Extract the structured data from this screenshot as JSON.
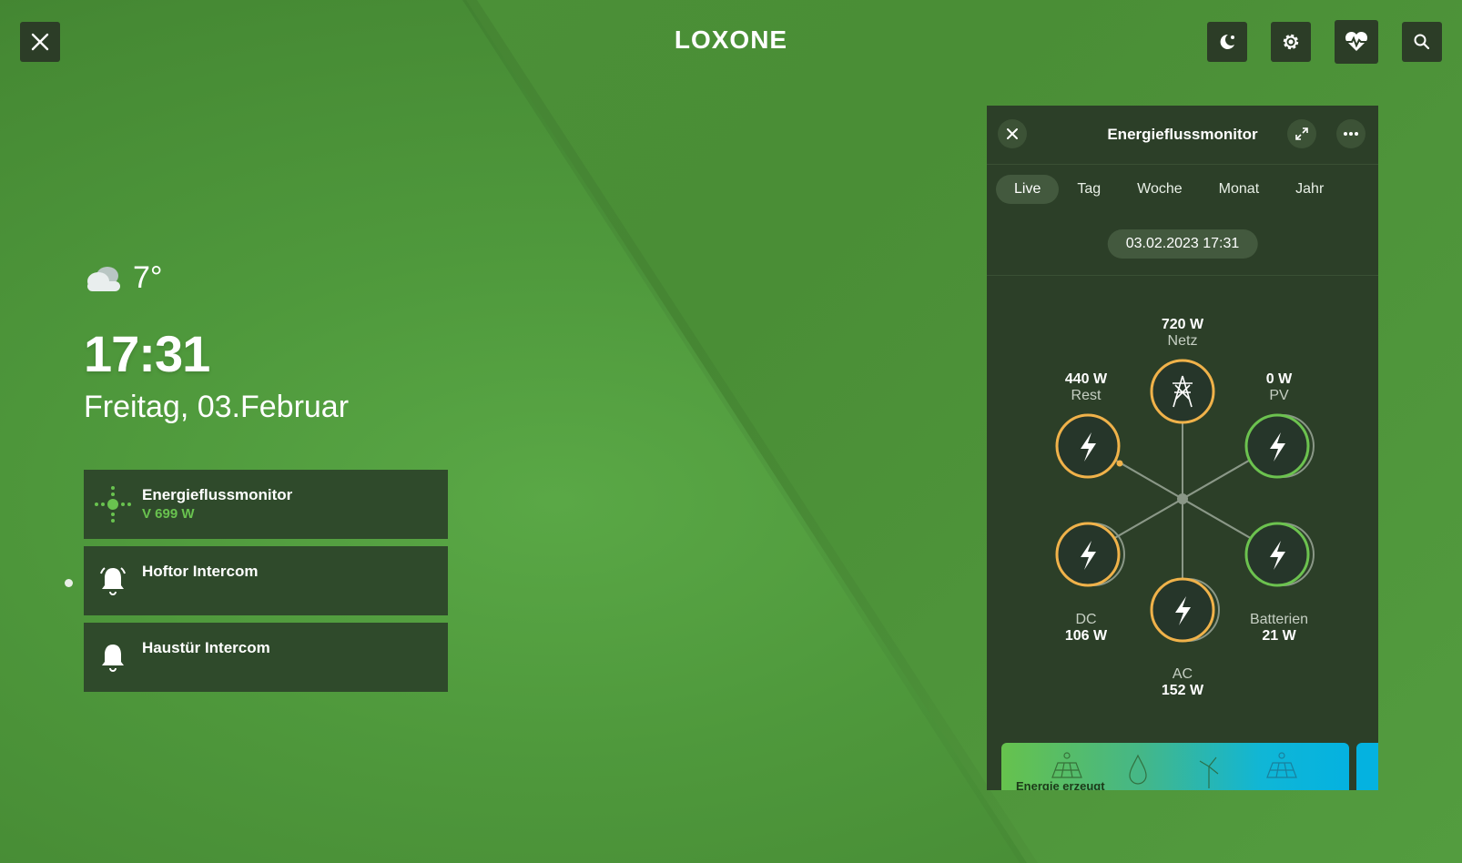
{
  "header": {
    "logo": "LOXONE"
  },
  "weather": {
    "temperature": "7°",
    "icon": "cloud-icon"
  },
  "clock": {
    "time": "17:31",
    "date": "Freitag, 03.Februar"
  },
  "tiles": [
    {
      "title": "Energieflussmonitor",
      "subtitle": "V 699 W",
      "icon": "energy-flow-icon"
    },
    {
      "title": "Hoftor Intercom",
      "subtitle": "",
      "icon": "bell-icon"
    },
    {
      "title": "Haustür Intercom",
      "subtitle": "",
      "icon": "bell-icon"
    }
  ],
  "panel": {
    "title": "Energieflussmonitor",
    "tabs": [
      "Live",
      "Tag",
      "Woche",
      "Monat",
      "Jahr"
    ],
    "active_tab": "Live",
    "timestamp": "03.02.2023 17:31",
    "nodes": {
      "netz": {
        "value": "720  W",
        "name": "Netz"
      },
      "rest": {
        "value": "440  W",
        "name": "Rest"
      },
      "pv": {
        "value": "0  W",
        "name": "PV"
      },
      "dc": {
        "value": "106  W",
        "name": "DC"
      },
      "batterien": {
        "value": "21  W",
        "name": "Batterien"
      },
      "ac": {
        "value": "152  W",
        "name": "AC"
      }
    },
    "banner_text": "Energie erzeugt",
    "colors": {
      "consumer": "#f0b24a",
      "producer": "#6cc24f",
      "panel": "#2c3f28"
    }
  }
}
